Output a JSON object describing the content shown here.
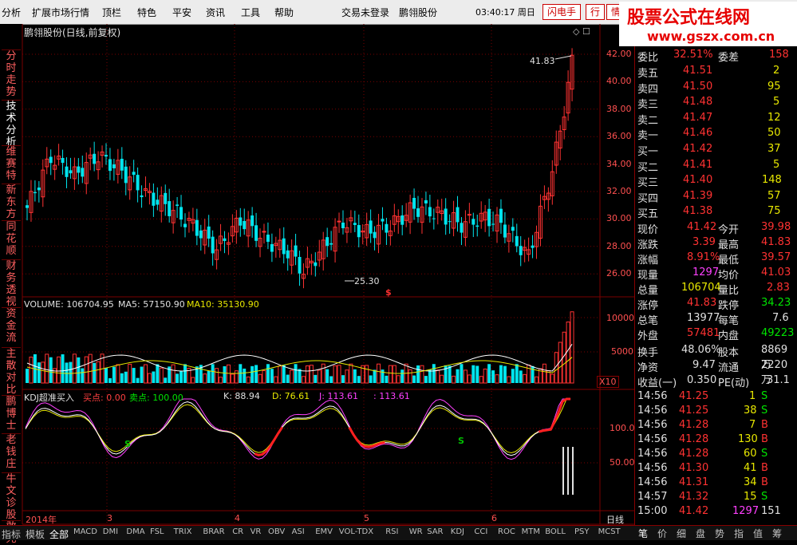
{
  "menu": [
    "分析",
    "扩展市场行情",
    "顶栏",
    "特色",
    "平安",
    "资讯",
    "工具",
    "帮助"
  ],
  "menu_center": [
    "交易未登录",
    "鹏翎股份"
  ],
  "clock": "03:40:17 周日",
  "quick": [
    "闪电手",
    "行",
    "情"
  ],
  "banner": {
    "line1": "股票公式在线网",
    "line2": "www.gszx.com.cn"
  },
  "left_tabs": [
    "分时走势",
    "技术分析",
    "维赛特",
    "新东方",
    "同花顺",
    "财务透视",
    "资金流",
    "主散对比",
    "鹏博士",
    "老钱庄",
    "牛文诊股",
    "敢死"
  ],
  "chart_title": "鹏翎股份(日线,前复权)",
  "price_axis": [
    "42.00",
    "40.00",
    "38.00",
    "36.00",
    "34.00",
    "32.00",
    "30.00",
    "28.00",
    "26.00"
  ],
  "annot_high": "41.83",
  "annot_low": "25.30",
  "dollar_mark": "$",
  "volume_label": {
    "v": "VOLUME: 106704.95",
    "ma5": "MA5: 57150.90",
    "ma10": "MA10: 35130.90"
  },
  "vol_axis": [
    "10000",
    "5000"
  ],
  "vol_scale": "X10",
  "kdj_label": {
    "name": "KDJ超准买入",
    "buy": "买点: 0.00",
    "sell": "卖点: 100.00",
    "k": "K: 88.94",
    "d": "D: 76.61",
    "j": "J: 113.61",
    "j2": ": 113.61"
  },
  "kdj_axis": [
    "100.0",
    "50.00"
  ],
  "kdj_marks": [
    "S",
    "S"
  ],
  "date_axis": [
    "2014年",
    "3",
    "4",
    "5",
    "6"
  ],
  "period": "日线",
  "quote": {
    "wei": [
      "委比",
      "32.51%",
      "委差",
      "158"
    ],
    "sell": [
      [
        "卖五",
        "41.51",
        "2"
      ],
      [
        "卖四",
        "41.50",
        "95"
      ],
      [
        "卖三",
        "41.48",
        "5"
      ],
      [
        "卖二",
        "41.47",
        "12"
      ],
      [
        "卖一",
        "41.46",
        "50"
      ]
    ],
    "buy": [
      [
        "买一",
        "41.42",
        "37"
      ],
      [
        "买二",
        "41.41",
        "5"
      ],
      [
        "买三",
        "41.40",
        "148"
      ],
      [
        "买四",
        "41.39",
        "57"
      ],
      [
        "买五",
        "41.38",
        "75"
      ]
    ],
    "stats": [
      [
        "现价",
        "41.42",
        "今开",
        "39.98"
      ],
      [
        "涨跌",
        "3.39",
        "最高",
        "41.83"
      ],
      [
        "涨幅",
        "8.91%",
        "最低",
        "39.57"
      ],
      [
        "现量",
        "1297",
        "均价",
        "41.03"
      ],
      [
        "总量",
        "106704",
        "量比",
        "2.83"
      ],
      [
        "涨停",
        "41.83",
        "跌停",
        "34.23"
      ],
      [
        "总笔",
        "13977",
        "每笔",
        "7.6"
      ],
      [
        "外盘",
        "57481",
        "内盘",
        "49223"
      ]
    ],
    "stats2": [
      [
        "换手",
        "48.06%",
        "股本",
        "8869万"
      ],
      [
        "净资",
        "9.47",
        "流通",
        "2220万"
      ],
      [
        "收益(一)",
        "0.350",
        "PE(动)",
        "31.1"
      ]
    ],
    "ticks": [
      [
        "14:56",
        "41.25",
        "1",
        "S"
      ],
      [
        "14:56",
        "41.25",
        "38",
        "S"
      ],
      [
        "14:56",
        "41.28",
        "7",
        "B"
      ],
      [
        "14:56",
        "41.28",
        "130",
        "B"
      ],
      [
        "14:56",
        "41.28",
        "60",
        "S"
      ],
      [
        "14:56",
        "41.30",
        "41",
        "B"
      ],
      [
        "14:56",
        "41.31",
        "34",
        "B"
      ],
      [
        "14:57",
        "41.32",
        "15",
        "S"
      ],
      [
        "15:00",
        "41.42",
        "1297",
        "151"
      ]
    ]
  },
  "bottom_tabs": [
    "指标",
    "模板",
    "全部",
    "MACD",
    "DMI",
    "DMA",
    "FSL",
    "TRIX",
    "BRAR",
    "CR",
    "VR",
    "OBV",
    "ASI",
    "EMV",
    "VOL-TDX",
    "RSI",
    "WR",
    "SAR",
    "KDJ",
    "CCI",
    "ROC",
    "MTM",
    "BOLL",
    "PSY",
    "MCST"
  ],
  "right_tabs": [
    "笔",
    "价",
    "细",
    "盘",
    "势",
    "指",
    "值",
    "筹"
  ],
  "colors": {
    "up": "#ff3232",
    "down": "#00e5ee",
    "grid": "#7a0000",
    "yellow": "#ffff00",
    "green": "#00e400",
    "magenta": "#ff40ff"
  }
}
